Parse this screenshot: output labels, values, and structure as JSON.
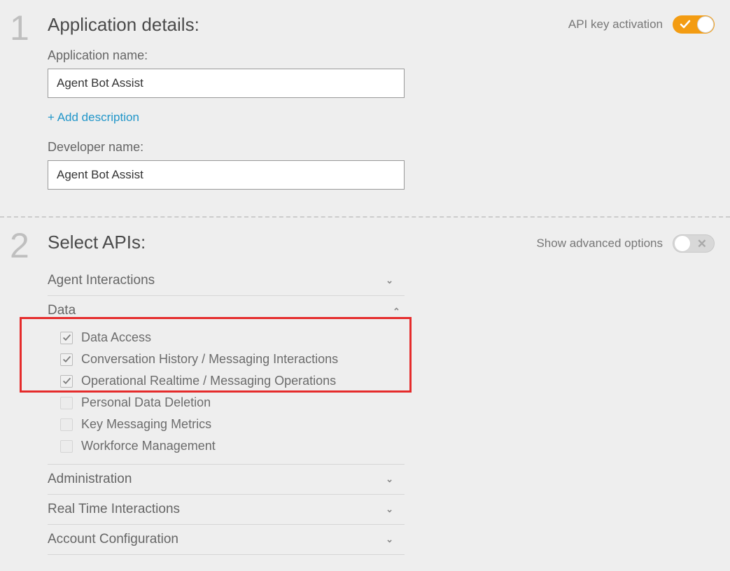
{
  "section1": {
    "title": "Application details:",
    "app_name_label": "Application name:",
    "app_name_value": "Agent Bot Assist",
    "add_description_link": "+ Add description",
    "developer_name_label": "Developer name:",
    "developer_name_value": "Agent Bot Assist",
    "api_key_activation_label": "API key activation",
    "api_key_activation_on": true
  },
  "section2": {
    "title": "Select APIs:",
    "advanced_label": "Show advanced options",
    "advanced_on": false,
    "groups": [
      {
        "label": "Agent Interactions",
        "expanded": false
      },
      {
        "label": "Data",
        "expanded": true,
        "items": [
          {
            "label": "Data Access",
            "checked": true
          },
          {
            "label": "Conversation History / Messaging Interactions",
            "checked": true
          },
          {
            "label": "Operational Realtime / Messaging Operations",
            "checked": true
          },
          {
            "label": "Personal Data Deletion",
            "checked": false
          },
          {
            "label": "Key Messaging Metrics",
            "checked": false
          },
          {
            "label": "Workforce Management",
            "checked": false
          }
        ]
      },
      {
        "label": "Administration",
        "expanded": false
      },
      {
        "label": "Real Time Interactions",
        "expanded": false
      },
      {
        "label": "Account Configuration",
        "expanded": false
      }
    ]
  },
  "step_numbers": {
    "one": "1",
    "two": "2"
  }
}
